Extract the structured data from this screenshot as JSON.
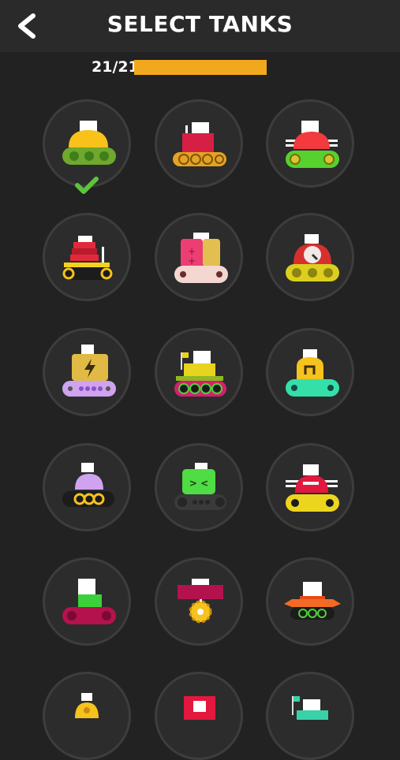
{
  "header": {
    "title": "SELECT TANKS",
    "back_icon": "back-arrow-icon"
  },
  "progress": {
    "label": "21/21",
    "unlocked": 21,
    "total": 21,
    "fraction": 1.0,
    "color": "#f2a81d"
  },
  "tanks": [
    {
      "name": "yellow-dome-tank",
      "selected": true
    },
    {
      "name": "red-box-tank",
      "selected": false
    },
    {
      "name": "red-dome-green-tank",
      "selected": false
    },
    {
      "name": "stacked-red-tank",
      "selected": false
    },
    {
      "name": "pink-crate-tank",
      "selected": false
    },
    {
      "name": "gauge-tank",
      "selected": false
    },
    {
      "name": "battery-tank",
      "selected": false
    },
    {
      "name": "flag-yellow-tank",
      "selected": false
    },
    {
      "name": "yellow-arch-tank",
      "selected": false
    },
    {
      "name": "lilac-dome-tank",
      "selected": false
    },
    {
      "name": "green-face-tank",
      "selected": false
    },
    {
      "name": "red-cap-tank",
      "selected": false
    },
    {
      "name": "magenta-block-tank",
      "selected": false
    },
    {
      "name": "crimson-wheel-tank",
      "selected": false
    },
    {
      "name": "orange-wing-tank",
      "selected": false
    },
    {
      "name": "yellow-partial-tank",
      "selected": false
    },
    {
      "name": "red-partial-tank",
      "selected": false
    },
    {
      "name": "teal-partial-tank",
      "selected": false
    }
  ]
}
